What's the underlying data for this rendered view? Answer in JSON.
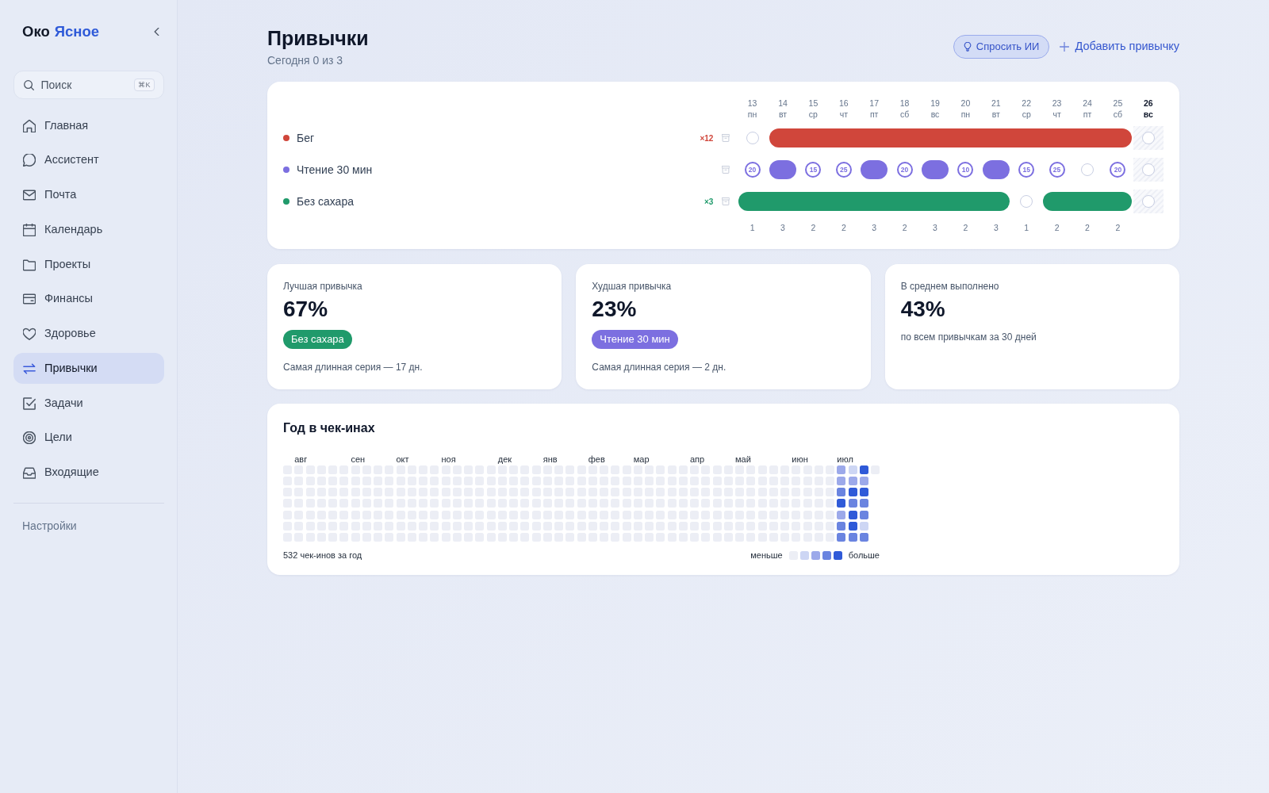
{
  "sidebar": {
    "brand": {
      "first": "Око",
      "second": "Ясное"
    },
    "search": {
      "placeholder": "Поиск",
      "shortcut": "⌘K"
    },
    "items": [
      {
        "label": "Главная",
        "selected": false
      },
      {
        "label": "Ассистент",
        "selected": false
      },
      {
        "label": "Почта",
        "selected": false
      },
      {
        "label": "Календарь",
        "selected": false
      },
      {
        "label": "Проекты",
        "selected": false
      },
      {
        "label": "Финансы",
        "selected": false
      },
      {
        "label": "Здоровье",
        "selected": false
      },
      {
        "label": "Привычки",
        "selected": true
      },
      {
        "label": "Задачи",
        "selected": false
      },
      {
        "label": "Цели",
        "selected": false
      },
      {
        "label": "Входящие",
        "selected": false
      }
    ],
    "settings": "Настройки"
  },
  "header": {
    "title": "Привычки",
    "subtitle": "Сегодня 0 из 3",
    "ask_ai": "Спросить ИИ",
    "add": "Добавить привычку"
  },
  "tracker": {
    "dates": [
      {
        "day": "13",
        "weekday": "пн",
        "today": false
      },
      {
        "day": "14",
        "weekday": "вт",
        "today": false
      },
      {
        "day": "15",
        "weekday": "ср",
        "today": false
      },
      {
        "day": "16",
        "weekday": "чт",
        "today": false
      },
      {
        "day": "17",
        "weekday": "пт",
        "today": false
      },
      {
        "day": "18",
        "weekday": "сб",
        "today": false
      },
      {
        "day": "19",
        "weekday": "вс",
        "today": false
      },
      {
        "day": "20",
        "weekday": "пн",
        "today": false
      },
      {
        "day": "21",
        "weekday": "вт",
        "today": false
      },
      {
        "day": "22",
        "weekday": "ср",
        "today": false
      },
      {
        "day": "23",
        "weekday": "чт",
        "today": false
      },
      {
        "day": "24",
        "weekday": "пт",
        "today": false
      },
      {
        "day": "25",
        "weekday": "сб",
        "today": false
      },
      {
        "day": "26",
        "weekday": "вс",
        "today": true
      }
    ],
    "habits": [
      {
        "name": "Бег",
        "color": "#d0463b",
        "streak": "×12",
        "days": [
          {
            "done": false
          },
          {
            "done": true
          },
          {
            "done": true
          },
          {
            "done": true
          },
          {
            "done": true
          },
          {
            "done": true
          },
          {
            "done": true
          },
          {
            "done": true
          },
          {
            "done": true
          },
          {
            "done": true
          },
          {
            "done": true
          },
          {
            "done": true
          },
          {
            "done": true
          },
          {
            "done": false
          }
        ]
      },
      {
        "name": "Чтение 30 мин",
        "color": "#7c6fe0",
        "days": [
          {
            "done": false,
            "amount": "20"
          },
          {
            "done": true
          },
          {
            "done": false,
            "amount": "15"
          },
          {
            "done": false,
            "amount": "25"
          },
          {
            "done": true
          },
          {
            "done": false,
            "amount": "20"
          },
          {
            "done": true
          },
          {
            "done": false,
            "amount": "10"
          },
          {
            "done": true
          },
          {
            "done": false,
            "amount": "15"
          },
          {
            "done": false,
            "amount": "25"
          },
          {
            "done": false
          },
          {
            "done": false,
            "amount": "20"
          },
          {
            "done": false
          }
        ]
      },
      {
        "name": "Без сахара",
        "color": "#209a6b",
        "streak": "×3",
        "days": [
          {
            "done": true
          },
          {
            "done": true
          },
          {
            "done": true
          },
          {
            "done": true
          },
          {
            "done": true
          },
          {
            "done": true
          },
          {
            "done": true
          },
          {
            "done": true
          },
          {
            "done": true
          },
          {
            "done": false
          },
          {
            "done": true
          },
          {
            "done": true
          },
          {
            "done": true
          },
          {
            "done": false
          }
        ]
      }
    ],
    "daily_totals": [
      "1",
      "3",
      "2",
      "2",
      "3",
      "2",
      "3",
      "2",
      "3",
      "1",
      "2",
      "2",
      "2"
    ]
  },
  "stats": [
    {
      "label": "Лучшая привычка",
      "value": "67%",
      "tag": {
        "label": "Без сахара",
        "color": "#209a6b"
      },
      "note": "Самая длинная серия — 17 дн."
    },
    {
      "label": "Худшая привычка",
      "value": "23%",
      "tag": {
        "label": "Чтение 30 мин",
        "color": "#7c6fe0"
      },
      "note": "Самая длинная серия — 2 дн."
    },
    {
      "label": "В среднем выполнено",
      "value": "43%",
      "note": "по всем привычкам за 30 дней"
    }
  ],
  "year": {
    "title": "Год в чек-инах",
    "weeks": [
      {
        "days": [
          {
            "color": "#eceef5"
          },
          {
            "color": "#eceef5"
          },
          {
            "color": "#eceef5"
          },
          {
            "color": "#eceef5"
          },
          {
            "color": "#eceef5"
          },
          {
            "color": "#eceef5"
          },
          {
            "color": "#eceef5"
          }
        ]
      },
      {
        "month": "авг",
        "days": [
          {
            "color": "#eceef5"
          },
          {
            "color": "#eceef5"
          },
          {
            "color": "#eceef5"
          },
          {
            "color": "#eceef5"
          },
          {
            "color": "#eceef5"
          },
          {
            "color": "#eceef5"
          },
          {
            "color": "#eceef5"
          }
        ]
      },
      {
        "days": [
          {
            "color": "#eceef5"
          },
          {
            "color": "#eceef5"
          },
          {
            "color": "#eceef5"
          },
          {
            "color": "#eceef5"
          },
          {
            "color": "#eceef5"
          },
          {
            "color": "#eceef5"
          },
          {
            "color": "#eceef5"
          }
        ]
      },
      {
        "days": [
          {
            "color": "#eceef5"
          },
          {
            "color": "#eceef5"
          },
          {
            "color": "#eceef5"
          },
          {
            "color": "#eceef5"
          },
          {
            "color": "#eceef5"
          },
          {
            "color": "#eceef5"
          },
          {
            "color": "#eceef5"
          }
        ]
      },
      {
        "days": [
          {
            "color": "#eceef5"
          },
          {
            "color": "#eceef5"
          },
          {
            "color": "#eceef5"
          },
          {
            "color": "#eceef5"
          },
          {
            "color": "#eceef5"
          },
          {
            "color": "#eceef5"
          },
          {
            "color": "#eceef5"
          }
        ]
      },
      {
        "days": [
          {
            "color": "#eceef5"
          },
          {
            "color": "#eceef5"
          },
          {
            "color": "#eceef5"
          },
          {
            "color": "#eceef5"
          },
          {
            "color": "#eceef5"
          },
          {
            "color": "#eceef5"
          },
          {
            "color": "#eceef5"
          }
        ]
      },
      {
        "month": "сен",
        "days": [
          {
            "color": "#eceef5"
          },
          {
            "color": "#eceef5"
          },
          {
            "color": "#eceef5"
          },
          {
            "color": "#eceef5"
          },
          {
            "color": "#eceef5"
          },
          {
            "color": "#eceef5"
          },
          {
            "color": "#eceef5"
          }
        ]
      },
      {
        "days": [
          {
            "color": "#eceef5"
          },
          {
            "color": "#eceef5"
          },
          {
            "color": "#eceef5"
          },
          {
            "color": "#eceef5"
          },
          {
            "color": "#eceef5"
          },
          {
            "color": "#eceef5"
          },
          {
            "color": "#eceef5"
          }
        ]
      },
      {
        "days": [
          {
            "color": "#eceef5"
          },
          {
            "color": "#eceef5"
          },
          {
            "color": "#eceef5"
          },
          {
            "color": "#eceef5"
          },
          {
            "color": "#eceef5"
          },
          {
            "color": "#eceef5"
          },
          {
            "color": "#eceef5"
          }
        ]
      },
      {
        "days": [
          {
            "color": "#eceef5"
          },
          {
            "color": "#eceef5"
          },
          {
            "color": "#eceef5"
          },
          {
            "color": "#eceef5"
          },
          {
            "color": "#eceef5"
          },
          {
            "color": "#eceef5"
          },
          {
            "color": "#eceef5"
          }
        ]
      },
      {
        "month": "окт",
        "days": [
          {
            "color": "#eceef5"
          },
          {
            "color": "#eceef5"
          },
          {
            "color": "#eceef5"
          },
          {
            "color": "#eceef5"
          },
          {
            "color": "#eceef5"
          },
          {
            "color": "#eceef5"
          },
          {
            "color": "#eceef5"
          }
        ]
      },
      {
        "days": [
          {
            "color": "#eceef5"
          },
          {
            "color": "#eceef5"
          },
          {
            "color": "#eceef5"
          },
          {
            "color": "#eceef5"
          },
          {
            "color": "#eceef5"
          },
          {
            "color": "#eceef5"
          },
          {
            "color": "#eceef5"
          }
        ]
      },
      {
        "days": [
          {
            "color": "#eceef5"
          },
          {
            "color": "#eceef5"
          },
          {
            "color": "#eceef5"
          },
          {
            "color": "#eceef5"
          },
          {
            "color": "#eceef5"
          },
          {
            "color": "#eceef5"
          },
          {
            "color": "#eceef5"
          }
        ]
      },
      {
        "days": [
          {
            "color": "#eceef5"
          },
          {
            "color": "#eceef5"
          },
          {
            "color": "#eceef5"
          },
          {
            "color": "#eceef5"
          },
          {
            "color": "#eceef5"
          },
          {
            "color": "#eceef5"
          },
          {
            "color": "#eceef5"
          }
        ]
      },
      {
        "month": "ноя",
        "days": [
          {
            "color": "#eceef5"
          },
          {
            "color": "#eceef5"
          },
          {
            "color": "#eceef5"
          },
          {
            "color": "#eceef5"
          },
          {
            "color": "#eceef5"
          },
          {
            "color": "#eceef5"
          },
          {
            "color": "#eceef5"
          }
        ]
      },
      {
        "days": [
          {
            "color": "#eceef5"
          },
          {
            "color": "#eceef5"
          },
          {
            "color": "#eceef5"
          },
          {
            "color": "#eceef5"
          },
          {
            "color": "#eceef5"
          },
          {
            "color": "#eceef5"
          },
          {
            "color": "#eceef5"
          }
        ]
      },
      {
        "days": [
          {
            "color": "#eceef5"
          },
          {
            "color": "#eceef5"
          },
          {
            "color": "#eceef5"
          },
          {
            "color": "#eceef5"
          },
          {
            "color": "#eceef5"
          },
          {
            "color": "#eceef5"
          },
          {
            "color": "#eceef5"
          }
        ]
      },
      {
        "days": [
          {
            "color": "#eceef5"
          },
          {
            "color": "#eceef5"
          },
          {
            "color": "#eceef5"
          },
          {
            "color": "#eceef5"
          },
          {
            "color": "#eceef5"
          },
          {
            "color": "#eceef5"
          },
          {
            "color": "#eceef5"
          }
        ]
      },
      {
        "days": [
          {
            "color": "#eceef5"
          },
          {
            "color": "#eceef5"
          },
          {
            "color": "#eceef5"
          },
          {
            "color": "#eceef5"
          },
          {
            "color": "#eceef5"
          },
          {
            "color": "#eceef5"
          },
          {
            "color": "#eceef5"
          }
        ]
      },
      {
        "month": "дек",
        "days": [
          {
            "color": "#eceef5"
          },
          {
            "color": "#eceef5"
          },
          {
            "color": "#eceef5"
          },
          {
            "color": "#eceef5"
          },
          {
            "color": "#eceef5"
          },
          {
            "color": "#eceef5"
          },
          {
            "color": "#eceef5"
          }
        ]
      },
      {
        "days": [
          {
            "color": "#eceef5"
          },
          {
            "color": "#eceef5"
          },
          {
            "color": "#eceef5"
          },
          {
            "color": "#eceef5"
          },
          {
            "color": "#eceef5"
          },
          {
            "color": "#eceef5"
          },
          {
            "color": "#eceef5"
          }
        ]
      },
      {
        "days": [
          {
            "color": "#eceef5"
          },
          {
            "color": "#eceef5"
          },
          {
            "color": "#eceef5"
          },
          {
            "color": "#eceef5"
          },
          {
            "color": "#eceef5"
          },
          {
            "color": "#eceef5"
          },
          {
            "color": "#eceef5"
          }
        ]
      },
      {
        "days": [
          {
            "color": "#eceef5"
          },
          {
            "color": "#eceef5"
          },
          {
            "color": "#eceef5"
          },
          {
            "color": "#eceef5"
          },
          {
            "color": "#eceef5"
          },
          {
            "color": "#eceef5"
          },
          {
            "color": "#eceef5"
          }
        ]
      },
      {
        "month": "янв",
        "days": [
          {
            "color": "#eceef5"
          },
          {
            "color": "#eceef5"
          },
          {
            "color": "#eceef5"
          },
          {
            "color": "#eceef5"
          },
          {
            "color": "#eceef5"
          },
          {
            "color": "#eceef5"
          },
          {
            "color": "#eceef5"
          }
        ]
      },
      {
        "days": [
          {
            "color": "#eceef5"
          },
          {
            "color": "#eceef5"
          },
          {
            "color": "#eceef5"
          },
          {
            "color": "#eceef5"
          },
          {
            "color": "#eceef5"
          },
          {
            "color": "#eceef5"
          },
          {
            "color": "#eceef5"
          }
        ]
      },
      {
        "days": [
          {
            "color": "#eceef5"
          },
          {
            "color": "#eceef5"
          },
          {
            "color": "#eceef5"
          },
          {
            "color": "#eceef5"
          },
          {
            "color": "#eceef5"
          },
          {
            "color": "#eceef5"
          },
          {
            "color": "#eceef5"
          }
        ]
      },
      {
        "days": [
          {
            "color": "#eceef5"
          },
          {
            "color": "#eceef5"
          },
          {
            "color": "#eceef5"
          },
          {
            "color": "#eceef5"
          },
          {
            "color": "#eceef5"
          },
          {
            "color": "#eceef5"
          },
          {
            "color": "#eceef5"
          }
        ]
      },
      {
        "month": "фев",
        "days": [
          {
            "color": "#eceef5"
          },
          {
            "color": "#eceef5"
          },
          {
            "color": "#eceef5"
          },
          {
            "color": "#eceef5"
          },
          {
            "color": "#eceef5"
          },
          {
            "color": "#eceef5"
          },
          {
            "color": "#eceef5"
          }
        ]
      },
      {
        "days": [
          {
            "color": "#eceef5"
          },
          {
            "color": "#eceef5"
          },
          {
            "color": "#eceef5"
          },
          {
            "color": "#eceef5"
          },
          {
            "color": "#eceef5"
          },
          {
            "color": "#eceef5"
          },
          {
            "color": "#eceef5"
          }
        ]
      },
      {
        "days": [
          {
            "color": "#eceef5"
          },
          {
            "color": "#eceef5"
          },
          {
            "color": "#eceef5"
          },
          {
            "color": "#eceef5"
          },
          {
            "color": "#eceef5"
          },
          {
            "color": "#eceef5"
          },
          {
            "color": "#eceef5"
          }
        ]
      },
      {
        "days": [
          {
            "color": "#eceef5"
          },
          {
            "color": "#eceef5"
          },
          {
            "color": "#eceef5"
          },
          {
            "color": "#eceef5"
          },
          {
            "color": "#eceef5"
          },
          {
            "color": "#eceef5"
          },
          {
            "color": "#eceef5"
          }
        ]
      },
      {
        "month": "мар",
        "days": [
          {
            "color": "#eceef5"
          },
          {
            "color": "#eceef5"
          },
          {
            "color": "#eceef5"
          },
          {
            "color": "#eceef5"
          },
          {
            "color": "#eceef5"
          },
          {
            "color": "#eceef5"
          },
          {
            "color": "#eceef5"
          }
        ]
      },
      {
        "days": [
          {
            "color": "#eceef5"
          },
          {
            "color": "#eceef5"
          },
          {
            "color": "#eceef5"
          },
          {
            "color": "#eceef5"
          },
          {
            "color": "#eceef5"
          },
          {
            "color": "#eceef5"
          },
          {
            "color": "#eceef5"
          }
        ]
      },
      {
        "days": [
          {
            "color": "#eceef5"
          },
          {
            "color": "#eceef5"
          },
          {
            "color": "#eceef5"
          },
          {
            "color": "#eceef5"
          },
          {
            "color": "#eceef5"
          },
          {
            "color": "#eceef5"
          },
          {
            "color": "#eceef5"
          }
        ]
      },
      {
        "days": [
          {
            "color": "#eceef5"
          },
          {
            "color": "#eceef5"
          },
          {
            "color": "#eceef5"
          },
          {
            "color": "#eceef5"
          },
          {
            "color": "#eceef5"
          },
          {
            "color": "#eceef5"
          },
          {
            "color": "#eceef5"
          }
        ]
      },
      {
        "days": [
          {
            "color": "#eceef5"
          },
          {
            "color": "#eceef5"
          },
          {
            "color": "#eceef5"
          },
          {
            "color": "#eceef5"
          },
          {
            "color": "#eceef5"
          },
          {
            "color": "#eceef5"
          },
          {
            "color": "#eceef5"
          }
        ]
      },
      {
        "month": "апр",
        "days": [
          {
            "color": "#eceef5"
          },
          {
            "color": "#eceef5"
          },
          {
            "color": "#eceef5"
          },
          {
            "color": "#eceef5"
          },
          {
            "color": "#eceef5"
          },
          {
            "color": "#eceef5"
          },
          {
            "color": "#eceef5"
          }
        ]
      },
      {
        "days": [
          {
            "color": "#eceef5"
          },
          {
            "color": "#eceef5"
          },
          {
            "color": "#eceef5"
          },
          {
            "color": "#eceef5"
          },
          {
            "color": "#eceef5"
          },
          {
            "color": "#eceef5"
          },
          {
            "color": "#eceef5"
          }
        ]
      },
      {
        "days": [
          {
            "color": "#eceef5"
          },
          {
            "color": "#eceef5"
          },
          {
            "color": "#eceef5"
          },
          {
            "color": "#eceef5"
          },
          {
            "color": "#eceef5"
          },
          {
            "color": "#eceef5"
          },
          {
            "color": "#eceef5"
          }
        ]
      },
      {
        "days": [
          {
            "color": "#eceef5"
          },
          {
            "color": "#eceef5"
          },
          {
            "color": "#eceef5"
          },
          {
            "color": "#eceef5"
          },
          {
            "color": "#eceef5"
          },
          {
            "color": "#eceef5"
          },
          {
            "color": "#eceef5"
          }
        ]
      },
      {
        "month": "май",
        "days": [
          {
            "color": "#eceef5"
          },
          {
            "color": "#eceef5"
          },
          {
            "color": "#eceef5"
          },
          {
            "color": "#eceef5"
          },
          {
            "color": "#eceef5"
          },
          {
            "color": "#eceef5"
          },
          {
            "color": "#eceef5"
          }
        ]
      },
      {
        "days": [
          {
            "color": "#eceef5"
          },
          {
            "color": "#eceef5"
          },
          {
            "color": "#eceef5"
          },
          {
            "color": "#eceef5"
          },
          {
            "color": "#eceef5"
          },
          {
            "color": "#eceef5"
          },
          {
            "color": "#eceef5"
          }
        ]
      },
      {
        "days": [
          {
            "color": "#eceef5"
          },
          {
            "color": "#eceef5"
          },
          {
            "color": "#eceef5"
          },
          {
            "color": "#eceef5"
          },
          {
            "color": "#eceef5"
          },
          {
            "color": "#eceef5"
          },
          {
            "color": "#eceef5"
          }
        ]
      },
      {
        "days": [
          {
            "color": "#eceef5"
          },
          {
            "color": "#eceef5"
          },
          {
            "color": "#eceef5"
          },
          {
            "color": "#eceef5"
          },
          {
            "color": "#eceef5"
          },
          {
            "color": "#eceef5"
          },
          {
            "color": "#eceef5"
          }
        ]
      },
      {
        "days": [
          {
            "color": "#eceef5"
          },
          {
            "color": "#eceef5"
          },
          {
            "color": "#eceef5"
          },
          {
            "color": "#eceef5"
          },
          {
            "color": "#eceef5"
          },
          {
            "color": "#eceef5"
          },
          {
            "color": "#eceef5"
          }
        ]
      },
      {
        "month": "июн",
        "days": [
          {
            "color": "#eceef5"
          },
          {
            "color": "#eceef5"
          },
          {
            "color": "#eceef5"
          },
          {
            "color": "#eceef5"
          },
          {
            "color": "#eceef5"
          },
          {
            "color": "#eceef5"
          },
          {
            "color": "#eceef5"
          }
        ]
      },
      {
        "days": [
          {
            "color": "#eceef5"
          },
          {
            "color": "#eceef5"
          },
          {
            "color": "#eceef5"
          },
          {
            "color": "#eceef5"
          },
          {
            "color": "#eceef5"
          },
          {
            "color": "#eceef5"
          },
          {
            "color": "#eceef5"
          }
        ]
      },
      {
        "days": [
          {
            "color": "#eceef5"
          },
          {
            "color": "#eceef5"
          },
          {
            "color": "#eceef5"
          },
          {
            "color": "#eceef5"
          },
          {
            "color": "#eceef5"
          },
          {
            "color": "#eceef5"
          },
          {
            "color": "#eceef5"
          }
        ]
      },
      {
        "days": [
          {
            "color": "#eceef5"
          },
          {
            "color": "#eceef5"
          },
          {
            "color": "#eceef5"
          },
          {
            "color": "#eceef5"
          },
          {
            "color": "#eceef5"
          },
          {
            "color": "#eceef5"
          },
          {
            "color": "#eceef5"
          }
        ]
      },
      {
        "month": "июл",
        "days": [
          {
            "color": "#9ca9ea"
          },
          {
            "color": "#9ca9ea"
          },
          {
            "color": "#6a84e0"
          },
          {
            "color": "#2f5ad8"
          },
          {
            "color": "#9ca9ea"
          },
          {
            "color": "#6a84e0"
          },
          {
            "color": "#6a84e0"
          }
        ]
      },
      {
        "days": [
          {
            "color": "#cdd6f4"
          },
          {
            "color": "#9ca9ea"
          },
          {
            "color": "#2f5ad8"
          },
          {
            "color": "#6a84e0"
          },
          {
            "color": "#2f5ad8"
          },
          {
            "color": "#2f5ad8"
          },
          {
            "color": "#6a84e0"
          }
        ]
      },
      {
        "days": [
          {
            "color": "#2f5ad8"
          },
          {
            "color": "#9ca9ea"
          },
          {
            "color": "#2f5ad8"
          },
          {
            "color": "#6a84e0"
          },
          {
            "color": "#6a84e0"
          },
          {
            "color": "#cdd6f4"
          },
          {
            "color": "#6a84e0"
          }
        ]
      },
      {
        "days": [
          {
            "color": "#eceef5"
          }
        ]
      }
    ],
    "summary": "532 чек-инов за год",
    "legend": {
      "less": "меньше",
      "more": "больше",
      "swatches": [
        {
          "color": "#eceef5"
        },
        {
          "color": "#cdd6f4"
        },
        {
          "color": "#9ca9ea"
        },
        {
          "color": "#6a84e0"
        },
        {
          "color": "#2f5ad8"
        }
      ]
    }
  }
}
